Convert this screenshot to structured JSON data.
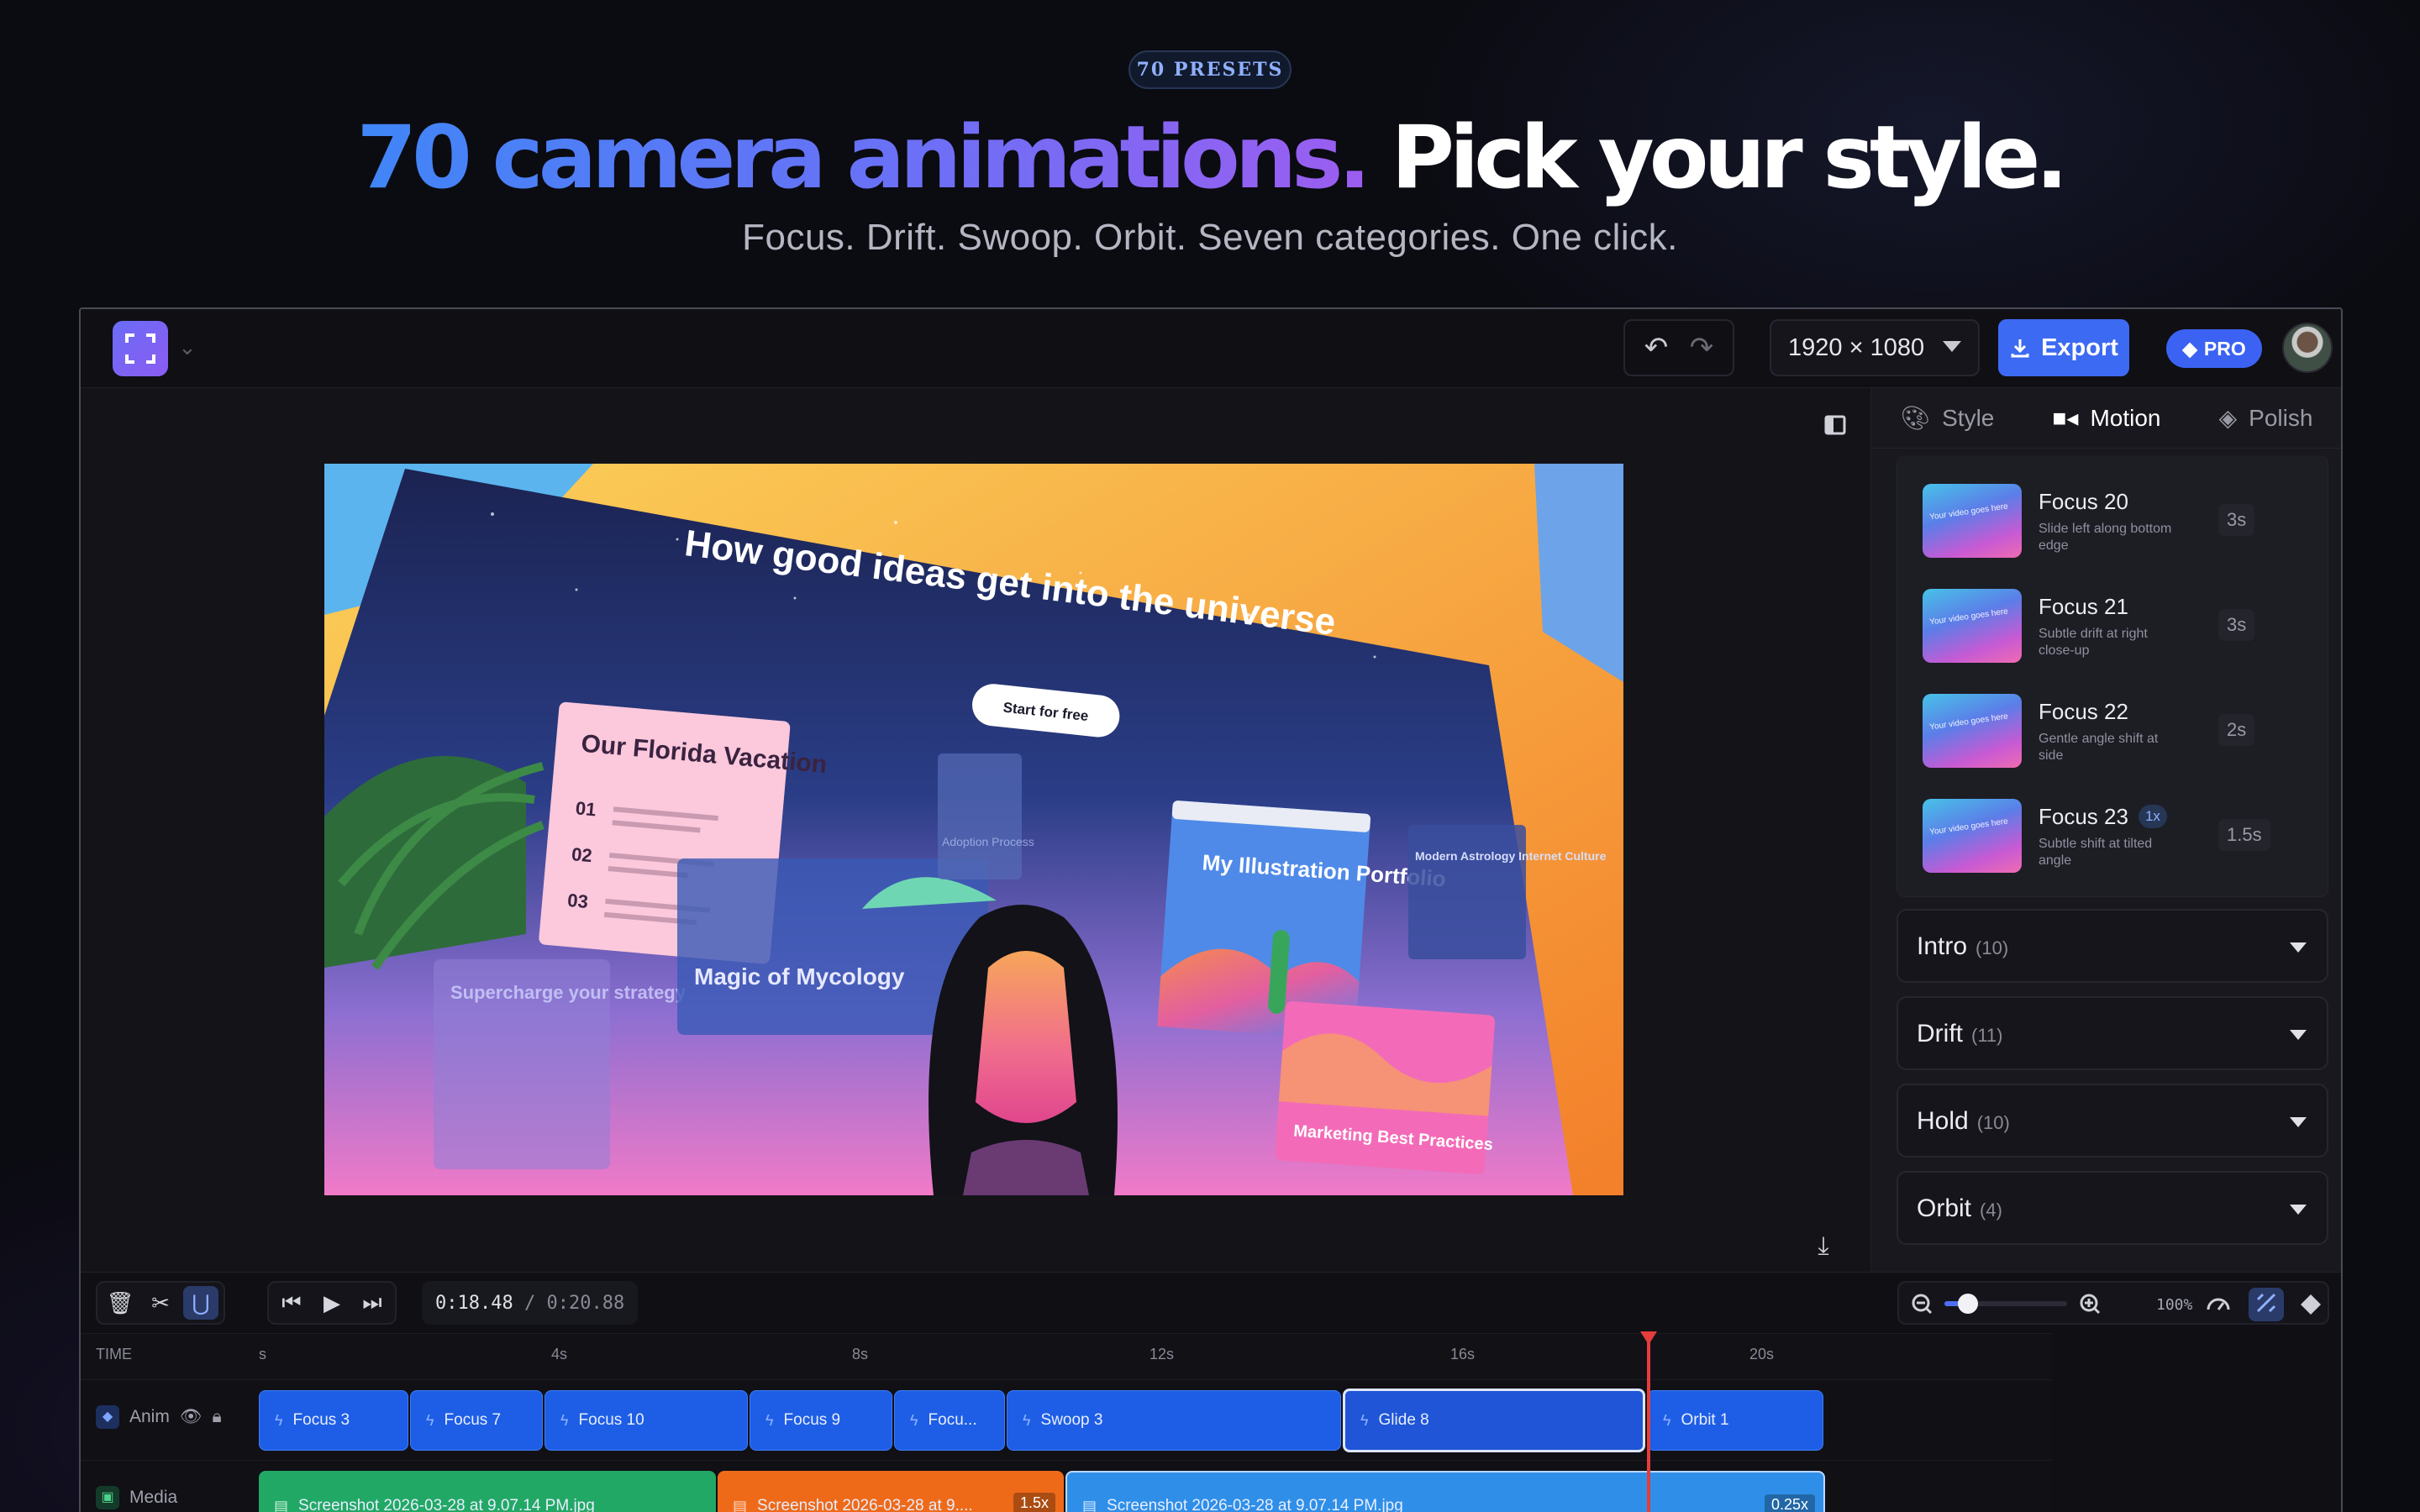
{
  "hero": {
    "badge": "70 PRESETS",
    "headline_gradient": "70 camera animations.",
    "headline_white": "Pick your style.",
    "subtitle": "Focus. Drift. Swoop. Orbit. Seven categories. One click."
  },
  "toolbar": {
    "resolution": "1920 × 1080",
    "export_label": "Export",
    "pro_label": "PRO"
  },
  "canvas": {
    "headline": "How good ideas get into the universe",
    "cta": "Start for free",
    "card_florida_title": "Our Florida Vacation",
    "card_florida_items": [
      "01",
      "02",
      "03"
    ],
    "card_mycology": "Magic of Mycology",
    "card_supercharge": "Supercharge your strategy",
    "card_adoption": "Adoption Process",
    "card_portfolio": "My Illustration Portfolio",
    "card_astrology": "Modern Astrology Internet Culture",
    "card_marketing": "Marketing Best Practices"
  },
  "right_panel": {
    "tabs": [
      {
        "label": "Style",
        "icon": "palette-icon"
      },
      {
        "label": "Motion",
        "icon": "video-camera-icon"
      },
      {
        "label": "Polish",
        "icon": "paint-bucket-icon"
      }
    ],
    "presets": [
      {
        "name": "Focus 20",
        "desc": "Slide left along bottom edge",
        "dur": "3s",
        "badge": ""
      },
      {
        "name": "Focus 21",
        "desc": "Subtle drift at right close-up",
        "dur": "3s",
        "badge": ""
      },
      {
        "name": "Focus 22",
        "desc": "Gentle angle shift at side",
        "dur": "2s",
        "badge": ""
      },
      {
        "name": "Focus 23",
        "desc": "Subtle shift at tilted angle",
        "dur": "1.5s",
        "badge": "1x"
      }
    ],
    "categories": [
      {
        "name": "Intro",
        "count": "(10)"
      },
      {
        "name": "Drift",
        "count": "(11)"
      },
      {
        "name": "Hold",
        "count": "(10)"
      },
      {
        "name": "Orbit",
        "count": "(4)"
      }
    ]
  },
  "timeline": {
    "current_time": "0:18.48",
    "separator": "/",
    "total_time": "0:20.88",
    "zoom_label": "100%",
    "time_header": "TIME",
    "ticks": [
      "s",
      "4s",
      "8s",
      "12s",
      "16s",
      "20s"
    ],
    "anim_track_label": "Anim",
    "media_track_label": "Media",
    "anim_clips": [
      "Focus 3",
      "Focus 7",
      "Focus 10",
      "Focus 9",
      "Focu...",
      "Swoop 3",
      "Glide 8",
      "Orbit 1"
    ],
    "media_clips": [
      {
        "label": "Screenshot 2026-03-28 at 9.07.14 PM.jpg",
        "speed": "",
        "color": "#22a865"
      },
      {
        "label": "Screenshot 2026-03-28 at 9....",
        "speed": "1.5x",
        "color": "#ee6a19"
      },
      {
        "label": "Screenshot 2026-03-28 at 9.07.14 PM.jpg",
        "speed": "0.25x",
        "color": "#2f8fe8"
      }
    ]
  },
  "colors": {
    "accent": "#3d6af2",
    "playhead": "#e53c3c",
    "anim_clip": "#1e5ee6"
  }
}
